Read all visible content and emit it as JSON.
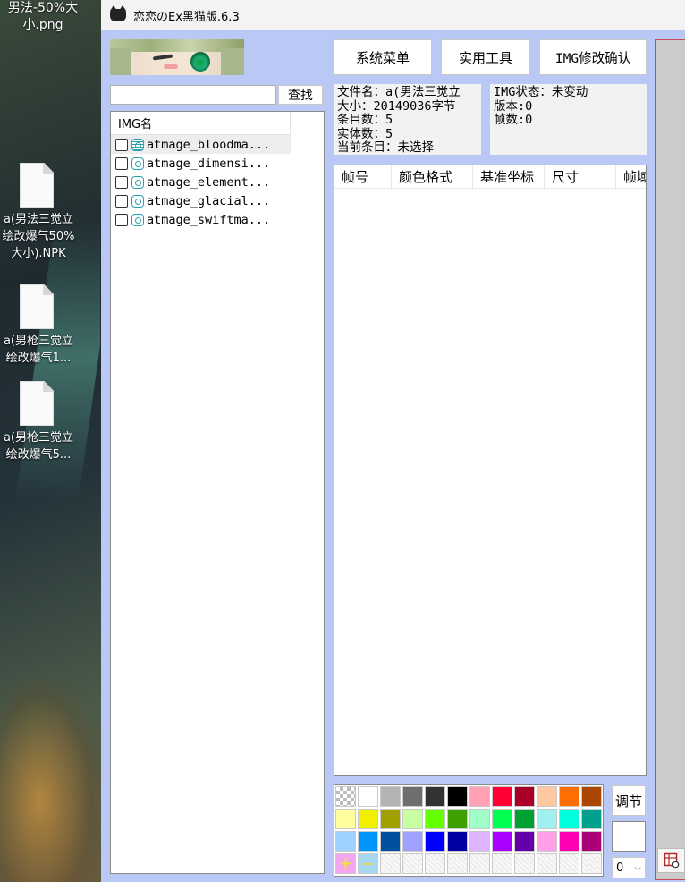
{
  "desktop": {
    "top_label": "男法-50%大小.png",
    "files": [
      {
        "label": "a(男法三觉立绘改爆气50%大小).NPK"
      },
      {
        "label": "a(男枪三觉立绘改爆气1..."
      },
      {
        "label": "a(男枪三觉立绘改爆气5..."
      }
    ]
  },
  "window": {
    "title": "恋恋のEx黑猫版.6.3"
  },
  "toolbar": {
    "system_menu": "系统菜单",
    "utility_tools": "实用工具",
    "img_confirm": "IMG修改确认"
  },
  "search": {
    "value": "",
    "button": "查找"
  },
  "img_list": {
    "header": "IMG名",
    "items": [
      {
        "name": "atmage_bloodma..."
      },
      {
        "name": "atmage_dimensi..."
      },
      {
        "name": "atmage_element..."
      },
      {
        "name": "atmage_glacial..."
      },
      {
        "name": "atmage_swiftma..."
      }
    ]
  },
  "file_info": {
    "line1": "文件名：a(男法三觉立",
    "line2": "大小：20149036字节",
    "line3": "条目数：5",
    "line4": "实体数：5",
    "line5": "当前条目：未选择"
  },
  "img_info": {
    "status": "IMG状态：未变动",
    "version": "版本:0",
    "frames": "帧数:0"
  },
  "frames_table": {
    "columns": [
      "帧号",
      "颜色格式",
      "基准坐标",
      "尺寸",
      "帧域"
    ]
  },
  "palette": {
    "rows": [
      [
        "checker",
        "#ffffff",
        "#b4b4b4",
        "#6e6e6e",
        "#323232",
        "#000000",
        "#ffa0b4",
        "#ff0032",
        "#aa0028",
        "#ffc8a0",
        "#ff6e00",
        "#aa4600"
      ],
      [
        "#ffffa0",
        "#f0f000",
        "#a0a000",
        "#c8ffa0",
        "#64ff00",
        "#3ca000",
        "#a0ffc8",
        "#00ff50",
        "#00a032",
        "#a0f0f0",
        "#00ffdc",
        "#00a08c"
      ],
      [
        "#a0d2ff",
        "#0096ff",
        "#0050a0",
        "#a0a0ff",
        "#0000ff",
        "#0000a0",
        "#dcb4ff",
        "#aa00ff",
        "#6400aa",
        "#ffa0e6",
        "#ff00b4",
        "#aa0078"
      ]
    ],
    "add_label": "+",
    "remove_label": "−"
  },
  "side_controls": {
    "adjust": "调节",
    "select_value": "0"
  }
}
